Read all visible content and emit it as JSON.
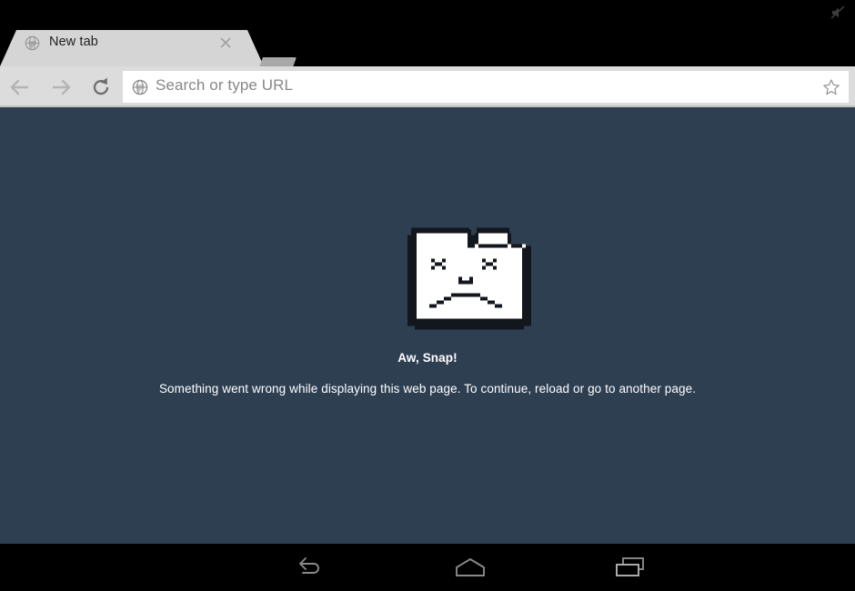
{
  "status_bar": {
    "icon": "mute-off-icon"
  },
  "tab_strip": {
    "tabs": [
      {
        "favicon": "globe-icon",
        "title": "New tab",
        "close": "close-icon"
      }
    ],
    "new_tab_button_label": "new-tab-button"
  },
  "toolbar": {
    "back_label": "Back",
    "forward_label": "Forward",
    "reload_label": "Reload",
    "omnibox": {
      "icon": "globe-icon",
      "value": "",
      "placeholder": "Search or type URL",
      "bookmark_icon": "star-outline-icon"
    }
  },
  "content": {
    "graphic": "sad-folder-icon",
    "title": "Aw, Snap!",
    "message": "Something went wrong while displaying this web page. To continue, reload or go to another page."
  },
  "nav_bar": {
    "back": "back-arrow-icon",
    "home": "home-icon",
    "recents": "recent-apps-icon"
  },
  "colors": {
    "status_bar": "#000000",
    "tab_strip": "#000000",
    "tab_active": "#d5d5d5",
    "new_tab_button": "#a8a8a8",
    "toolbar": "#dcdcdc",
    "omnibox": "#ffffff",
    "page_background": "#2f3f52",
    "page_text": "#ffffff",
    "nav_bar": "#000000",
    "nav_icon": "#8a8a8a"
  }
}
